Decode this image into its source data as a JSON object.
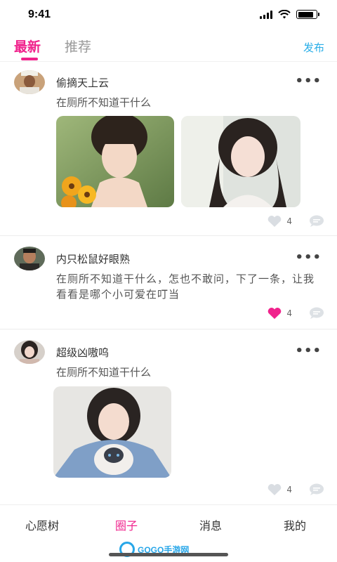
{
  "status_bar": {
    "time": "9:41",
    "battery_level": 0.85
  },
  "header": {
    "tabs": [
      {
        "label": "最新",
        "active": true
      },
      {
        "label": "推荐",
        "active": false
      }
    ],
    "publish_label": "发布"
  },
  "posts": [
    {
      "author": "偷摘天上云",
      "text": "在厕所不知道干什么",
      "photos": 2,
      "likes": "4",
      "liked": false
    },
    {
      "author": "内只松鼠好眼熟",
      "text": "在厕所不知道干什么，怎也不敢问，下了一条，让我看看是哪个小可爱在叮当",
      "photos": 0,
      "likes": "4",
      "liked": true
    },
    {
      "author": "超级凶嗷呜",
      "text": "在厕所不知道干什么",
      "photos": 1,
      "likes": "4",
      "liked": false
    }
  ],
  "bottom_nav": {
    "items": [
      {
        "label": "心愿树",
        "active": false
      },
      {
        "label": "圈子",
        "active": true
      },
      {
        "label": "消息",
        "active": false
      },
      {
        "label": "我的",
        "active": false
      }
    ]
  },
  "watermark": "GOGO手游网",
  "colors": {
    "accent": "#f0228c",
    "link": "#29aee8",
    "like_inactive": "#d9dde2"
  },
  "icons": [
    "signal-icon",
    "wifi-icon",
    "battery-icon",
    "more-icon",
    "heart-icon",
    "comment-icon"
  ]
}
